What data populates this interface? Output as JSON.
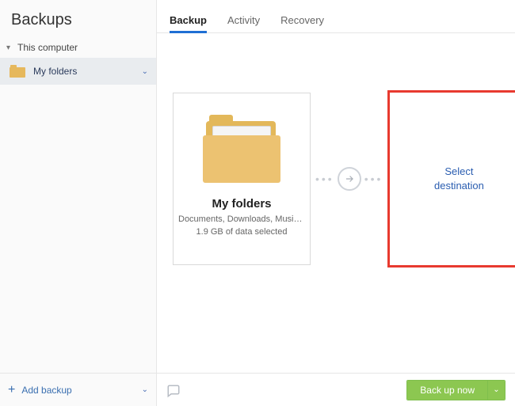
{
  "sidebar": {
    "title": "Backups",
    "section_label": "This computer",
    "items": [
      {
        "label": "My folders",
        "icon": "folder-icon",
        "selected": true
      }
    ],
    "add_backup_label": "Add backup"
  },
  "tabs": [
    {
      "id": "backup",
      "label": "Backup",
      "active": true
    },
    {
      "id": "activity",
      "label": "Activity",
      "active": false
    },
    {
      "id": "recovery",
      "label": "Recovery",
      "active": false
    }
  ],
  "source_card": {
    "title": "My folders",
    "subtitle": "Documents, Downloads, Music, Pi…",
    "size_line": "1.9 GB of data selected"
  },
  "destination_card": {
    "label_line1": "Select",
    "label_line2": "destination",
    "highlight_color": "#e83a2f"
  },
  "footer": {
    "backup_now_label": "Back up now"
  }
}
